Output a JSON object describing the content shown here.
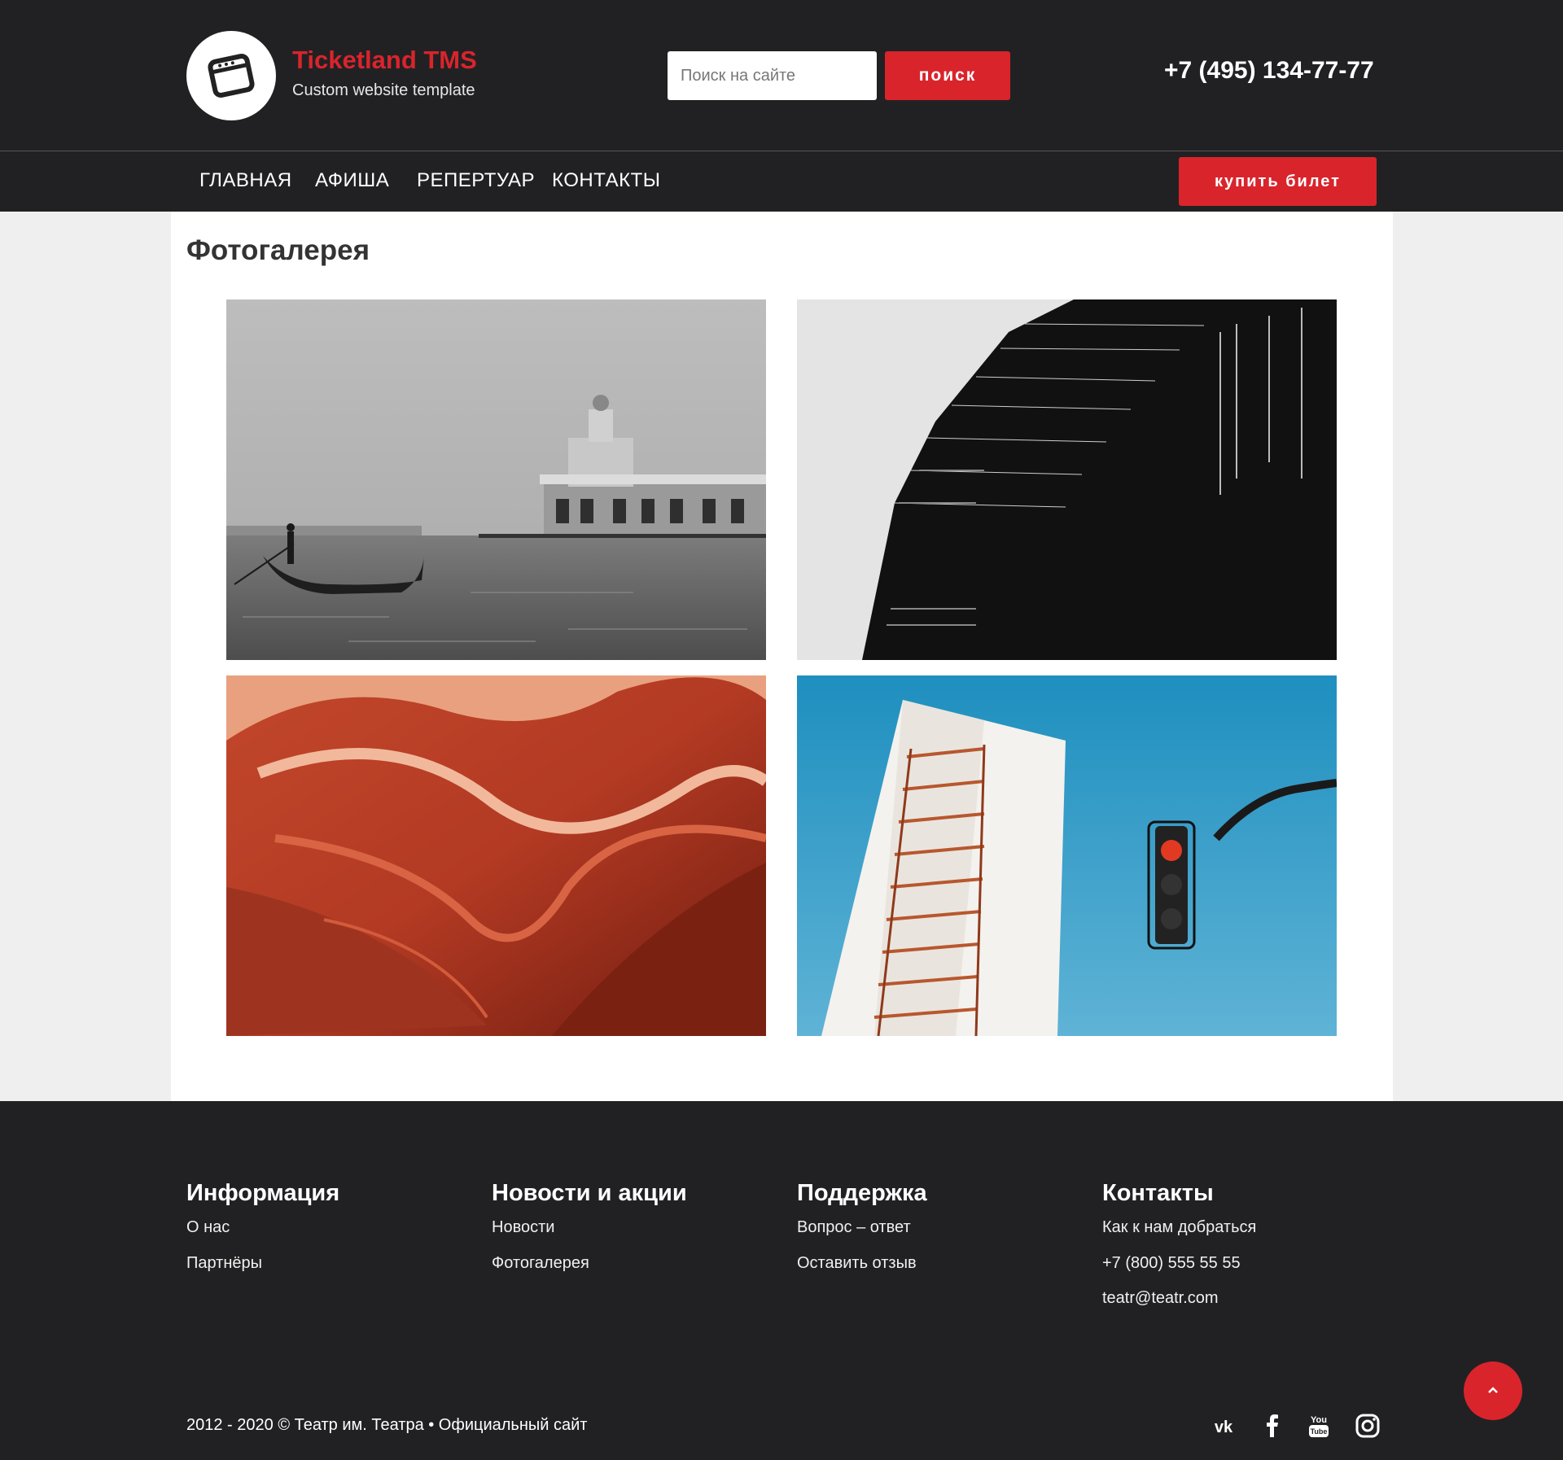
{
  "header": {
    "brand_title": "Ticketland TMS",
    "brand_sub": "Custom website template",
    "search_placeholder": "Поиск на сайте",
    "search_button": "поиск",
    "phone": "+7 (495) 134-77-77"
  },
  "nav": {
    "items": [
      "ГЛАВНАЯ",
      "АФИША",
      "РЕПЕРТУАР",
      "КОНТАКТЫ"
    ],
    "buy_button": "купить билет"
  },
  "main": {
    "title": "Фотогалерея",
    "photos": [
      "venice-gondola-photo",
      "building-facade-photo",
      "red-canyon-photo",
      "fire-escape-traffic-light-photo"
    ]
  },
  "footer": {
    "columns": [
      {
        "heading": "Информация",
        "links": [
          "О нас",
          "Партнёры"
        ]
      },
      {
        "heading": "Новости и акции",
        "links": [
          "Новости",
          "Фотогалерея"
        ]
      },
      {
        "heading": "Поддержка",
        "links": [
          "Вопрос – ответ",
          "Оставить отзыв"
        ]
      },
      {
        "heading": "Контакты",
        "links": [
          "Как к нам добраться",
          "+7 (800) 555 55 55",
          "teatr@teatr.com"
        ]
      }
    ],
    "copyright": "2012 - 2020 © Театр им. Театра • Официальный сайт",
    "social": [
      "vk-icon",
      "facebook-icon",
      "youtube-icon",
      "instagram-icon"
    ]
  },
  "colors": {
    "accent": "#d9242c",
    "dark": "#212123",
    "page_bg": "#efefef"
  }
}
